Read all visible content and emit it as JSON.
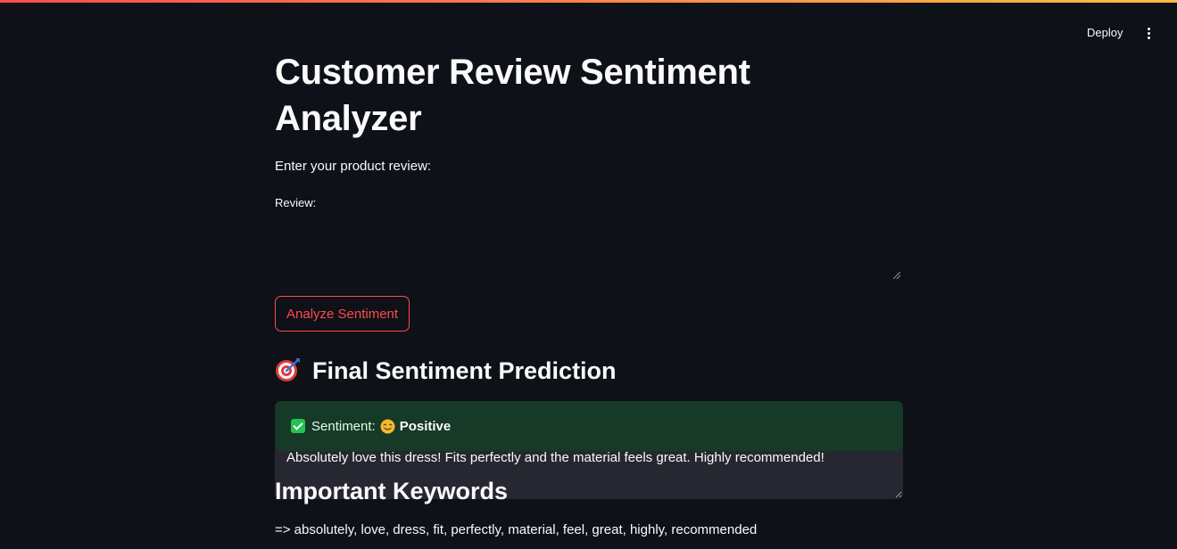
{
  "header": {
    "deploy_label": "Deploy",
    "menu_icon": "more-vertical-icon"
  },
  "colors": {
    "background": "#0e1117",
    "accent": "#ff4b4b",
    "input_bg": "#262730",
    "success_bg": "#173928"
  },
  "main": {
    "title": "Customer Review Sentiment Analyzer",
    "subtitle": "Enter your product review:",
    "review_field": {
      "label": "Review:",
      "value": "Absolutely love this dress! Fits perfectly and the material feels great. Highly recommended!"
    },
    "analyze_button_label": "Analyze Sentiment",
    "prediction": {
      "heading": "Final Sentiment Prediction",
      "heading_icon": "target-icon",
      "result_label": "Sentiment:",
      "result_icons": [
        "check-icon",
        "smile-icon"
      ],
      "result_value": "Positive"
    },
    "keywords": {
      "heading": "Important Keywords",
      "text": "=> absolutely, love, dress, fit, perfectly, material, feel, great, highly, recommended"
    }
  }
}
